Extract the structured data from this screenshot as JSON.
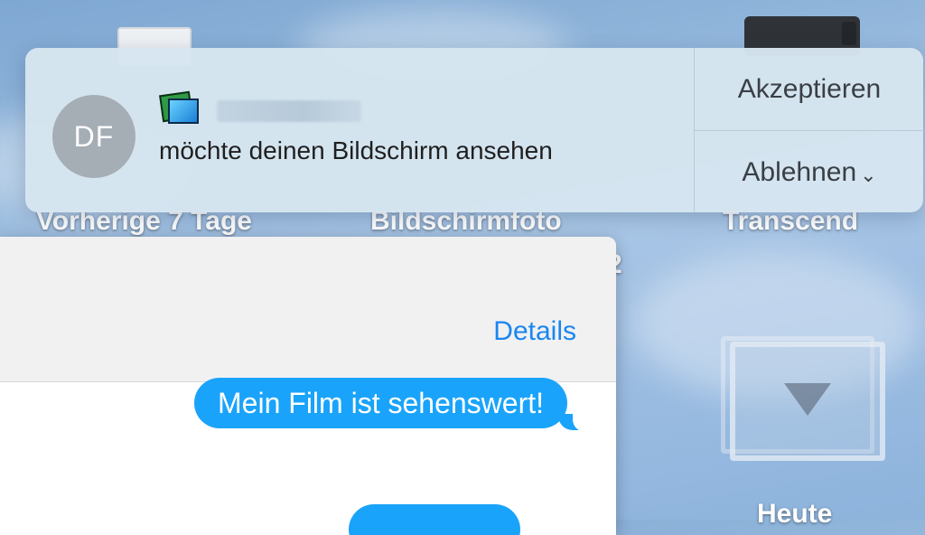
{
  "desktop": {
    "icons": [
      {
        "label": "Vorherige 7 Tage"
      },
      {
        "label": "Bildschirmfoto"
      },
      {
        "label": "Transcend"
      },
      {
        "label": "Heute"
      }
    ],
    "partial_glyph": "2"
  },
  "notification": {
    "avatar_initials": "DF",
    "app_icon": "screen-sharing-icon",
    "message": "möchte deinen Bildschirm ansehen",
    "accept_label": "Akzeptieren",
    "decline_label": "Ablehnen",
    "decline_chevron": "⌄"
  },
  "messages": {
    "details_label": "Details",
    "bubbles": [
      {
        "text": "Mein Film ist sehenswert!"
      }
    ],
    "bubble_color": "#1aa3fb",
    "link_color": "#1a86f0"
  }
}
